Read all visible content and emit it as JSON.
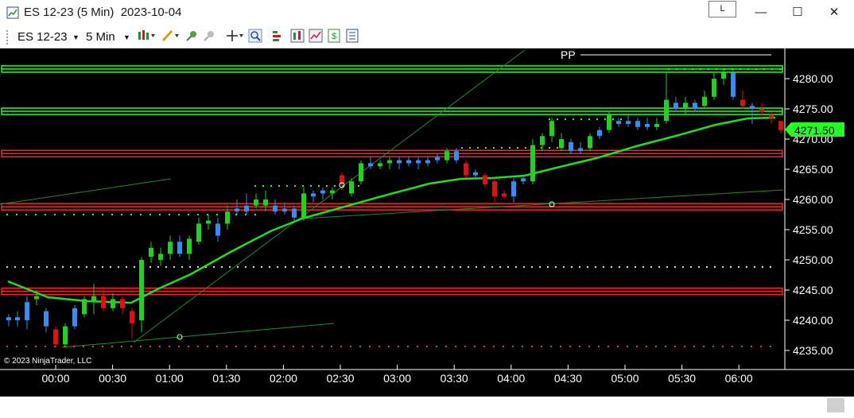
{
  "window": {
    "title": "ES 12-23 (5 Min)  2023-10-04",
    "link_label": "L",
    "minimize_glyph": "—",
    "maximize_glyph": "☐",
    "close_glyph": "✕"
  },
  "toolbar": {
    "instrument": "ES 12-23",
    "interval": "5 Min",
    "icons": [
      "bar-type-icon",
      "drawing-tool-icon",
      "pin-icon",
      "unpin-icon",
      "crosshair-icon",
      "zoom-icon",
      "properties-icon",
      "indicators-icon",
      "strategies-icon",
      "chart-trader-icon",
      "data-box-icon"
    ]
  },
  "chart": {
    "copyright": "© 2023 NinjaTrader, LLC",
    "pp_label": "PP",
    "current_price": "4271.50",
    "price_ticks": [
      "4280.00",
      "4275.00",
      "4270.00",
      "4265.00",
      "4260.00",
      "4255.00",
      "4250.00",
      "4245.00",
      "4240.00",
      "4235.00"
    ],
    "time_ticks": [
      "00:00",
      "00:30",
      "01:00",
      "01:30",
      "02:00",
      "02:30",
      "03:00",
      "03:30",
      "04:00",
      "04:30",
      "05:00",
      "05:30",
      "06:00"
    ],
    "colors": {
      "up": "#22d022",
      "down": "#e01010",
      "neutral": "#3b8cf0",
      "support": "#ff2020",
      "resistance": "#22ff22",
      "ma": "#22dd22"
    }
  }
}
